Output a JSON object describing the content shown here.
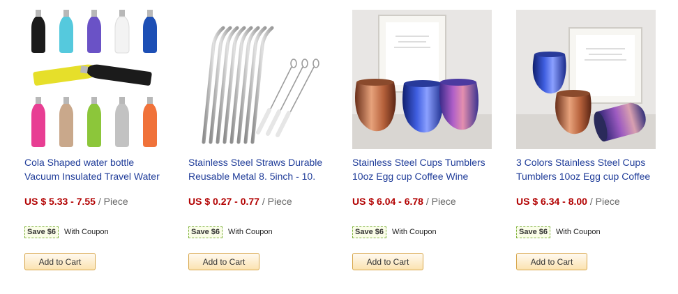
{
  "products": [
    {
      "title_lines": [
        "Cola Shaped water bottle",
        "Vacuum Insulated Travel Water"
      ],
      "price": "US $ 5.33 - 7.55",
      "unit": "/ Piece",
      "save": "Save $6",
      "coupon": "With Coupon",
      "cart": "Add to Cart",
      "image": "bottles-image"
    },
    {
      "title_lines": [
        "Stainless Steel Straws Durable",
        "Reusable Metal 8. 5inch - 10."
      ],
      "price": "US $ 0.27 - 0.77",
      "unit": "/ Piece",
      "save": "Save $6",
      "coupon": "With Coupon",
      "cart": "Add to Cart",
      "image": "straws-image"
    },
    {
      "title_lines": [
        "Stainless Steel Cups Tumblers",
        "10oz Egg cup Coffee Wine"
      ],
      "price": "US $ 6.04 - 6.78",
      "unit": "/ Piece",
      "save": "Save $6",
      "coupon": "With Coupon",
      "cart": "Add to Cart",
      "image": "cups-image"
    },
    {
      "title_lines": [
        "3 Colors Stainless Steel Cups",
        "Tumblers 10oz Egg cup Coffee"
      ],
      "price": "US $ 6.34 - 8.00",
      "unit": "/ Piece",
      "save": "Save $6",
      "coupon": "With Coupon",
      "cart": "Add to Cart",
      "image": "tumblers-image"
    }
  ],
  "colors": {
    "title": "#1f3c99",
    "price": "#b20000",
    "coupon_border": "#7fb33b"
  }
}
